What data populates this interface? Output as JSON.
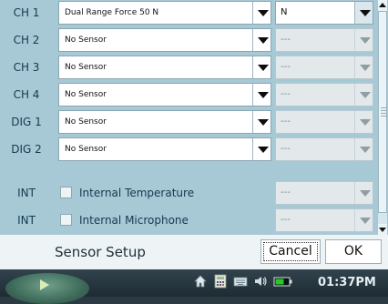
{
  "channels": [
    {
      "label": "CH 1",
      "sensor": "Dual Range Force 50 N",
      "unit": "N",
      "unit_enabled": true
    },
    {
      "label": "CH 2",
      "sensor": "No Sensor",
      "unit": "---",
      "unit_enabled": false
    },
    {
      "label": "CH 3",
      "sensor": "No Sensor",
      "unit": "---",
      "unit_enabled": false
    },
    {
      "label": "CH 4",
      "sensor": "No Sensor",
      "unit": "---",
      "unit_enabled": false
    },
    {
      "label": "DIG 1",
      "sensor": "No Sensor",
      "unit": "---",
      "unit_enabled": false
    },
    {
      "label": "DIG 2",
      "sensor": "No Sensor",
      "unit": "---",
      "unit_enabled": false
    }
  ],
  "internal": [
    {
      "label": "INT",
      "name": "Internal Temperature",
      "checked": false,
      "unit": "---"
    },
    {
      "label": "INT",
      "name": "Internal Microphone",
      "checked": false,
      "unit": "---"
    }
  ],
  "footer": {
    "title": "Sensor Setup",
    "cancel_label": "Cancel",
    "ok_label": "OK"
  },
  "taskbar": {
    "clock": "01:37PM",
    "icons": [
      "home-icon",
      "calculator-icon",
      "keyboard-icon",
      "speaker-icon",
      "battery-icon"
    ]
  },
  "colors": {
    "panel": "#a7c9d5",
    "footer": "#eef4f6",
    "taskbar": "#2c3a44",
    "battery": "#22cc22"
  }
}
